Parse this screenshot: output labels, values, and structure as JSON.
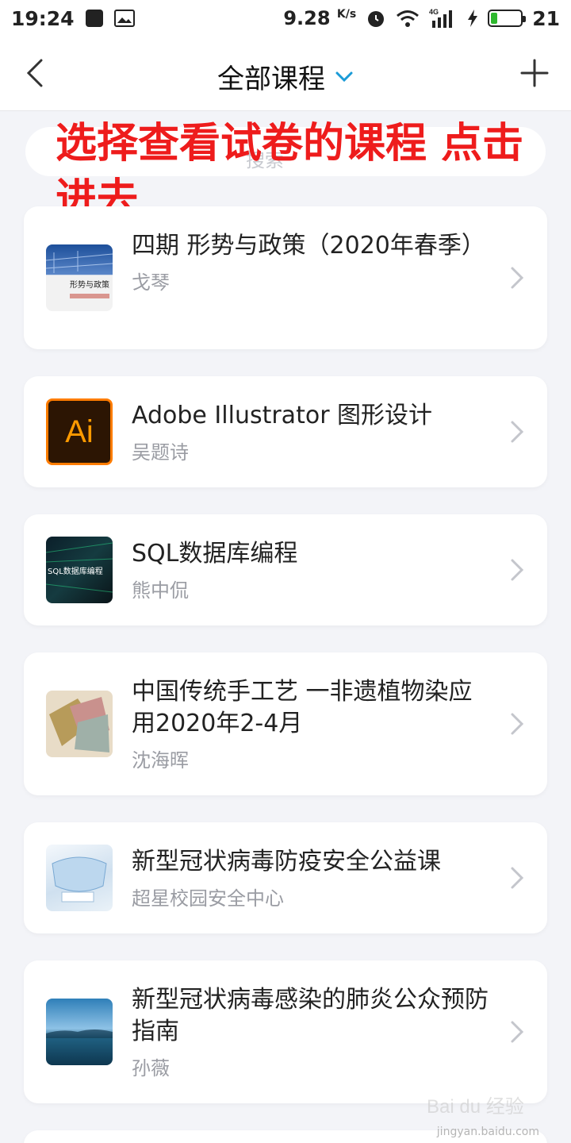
{
  "status_bar": {
    "time": "19:24",
    "net_speed": "9.28",
    "net_unit": "K/s",
    "signal": "4G",
    "battery_level": "21",
    "battery_fraction": 0.21
  },
  "nav": {
    "title": "全部课程",
    "back_icon": "chevron-left-icon",
    "add_icon": "plus-icon"
  },
  "search": {
    "placeholder": "搜索"
  },
  "annotation": {
    "text": "选择查看试卷的课程 点击进去"
  },
  "courses": [
    {
      "title": "四期 形势与政策（2020年春季）",
      "teacher": "戈琴"
    },
    {
      "title": "Adobe Illustrator 图形设计",
      "teacher": "吴题诗"
    },
    {
      "title": "SQL数据库编程",
      "teacher": "熊中侃"
    },
    {
      "title": "中国传统手工艺 一非遗植物染应用2020年2-4月",
      "teacher": "沈海晖"
    },
    {
      "title": "新型冠状病毒防疫安全公益课",
      "teacher": "超星校园安全中心"
    },
    {
      "title": "新型冠状病毒感染的肺炎公众预防指南",
      "teacher": "孙薇"
    }
  ],
  "thumb_labels": {
    "ai": "Ai",
    "sql": "SQL数据库编程",
    "policy": "形势与政策"
  },
  "watermark": {
    "text": "Bai du 经验",
    "sub": "jingyan.baidu.com"
  },
  "colors": {
    "accent": "#1a9bd7",
    "annotation": "#ee1c1c",
    "background": "#f3f4f8"
  }
}
